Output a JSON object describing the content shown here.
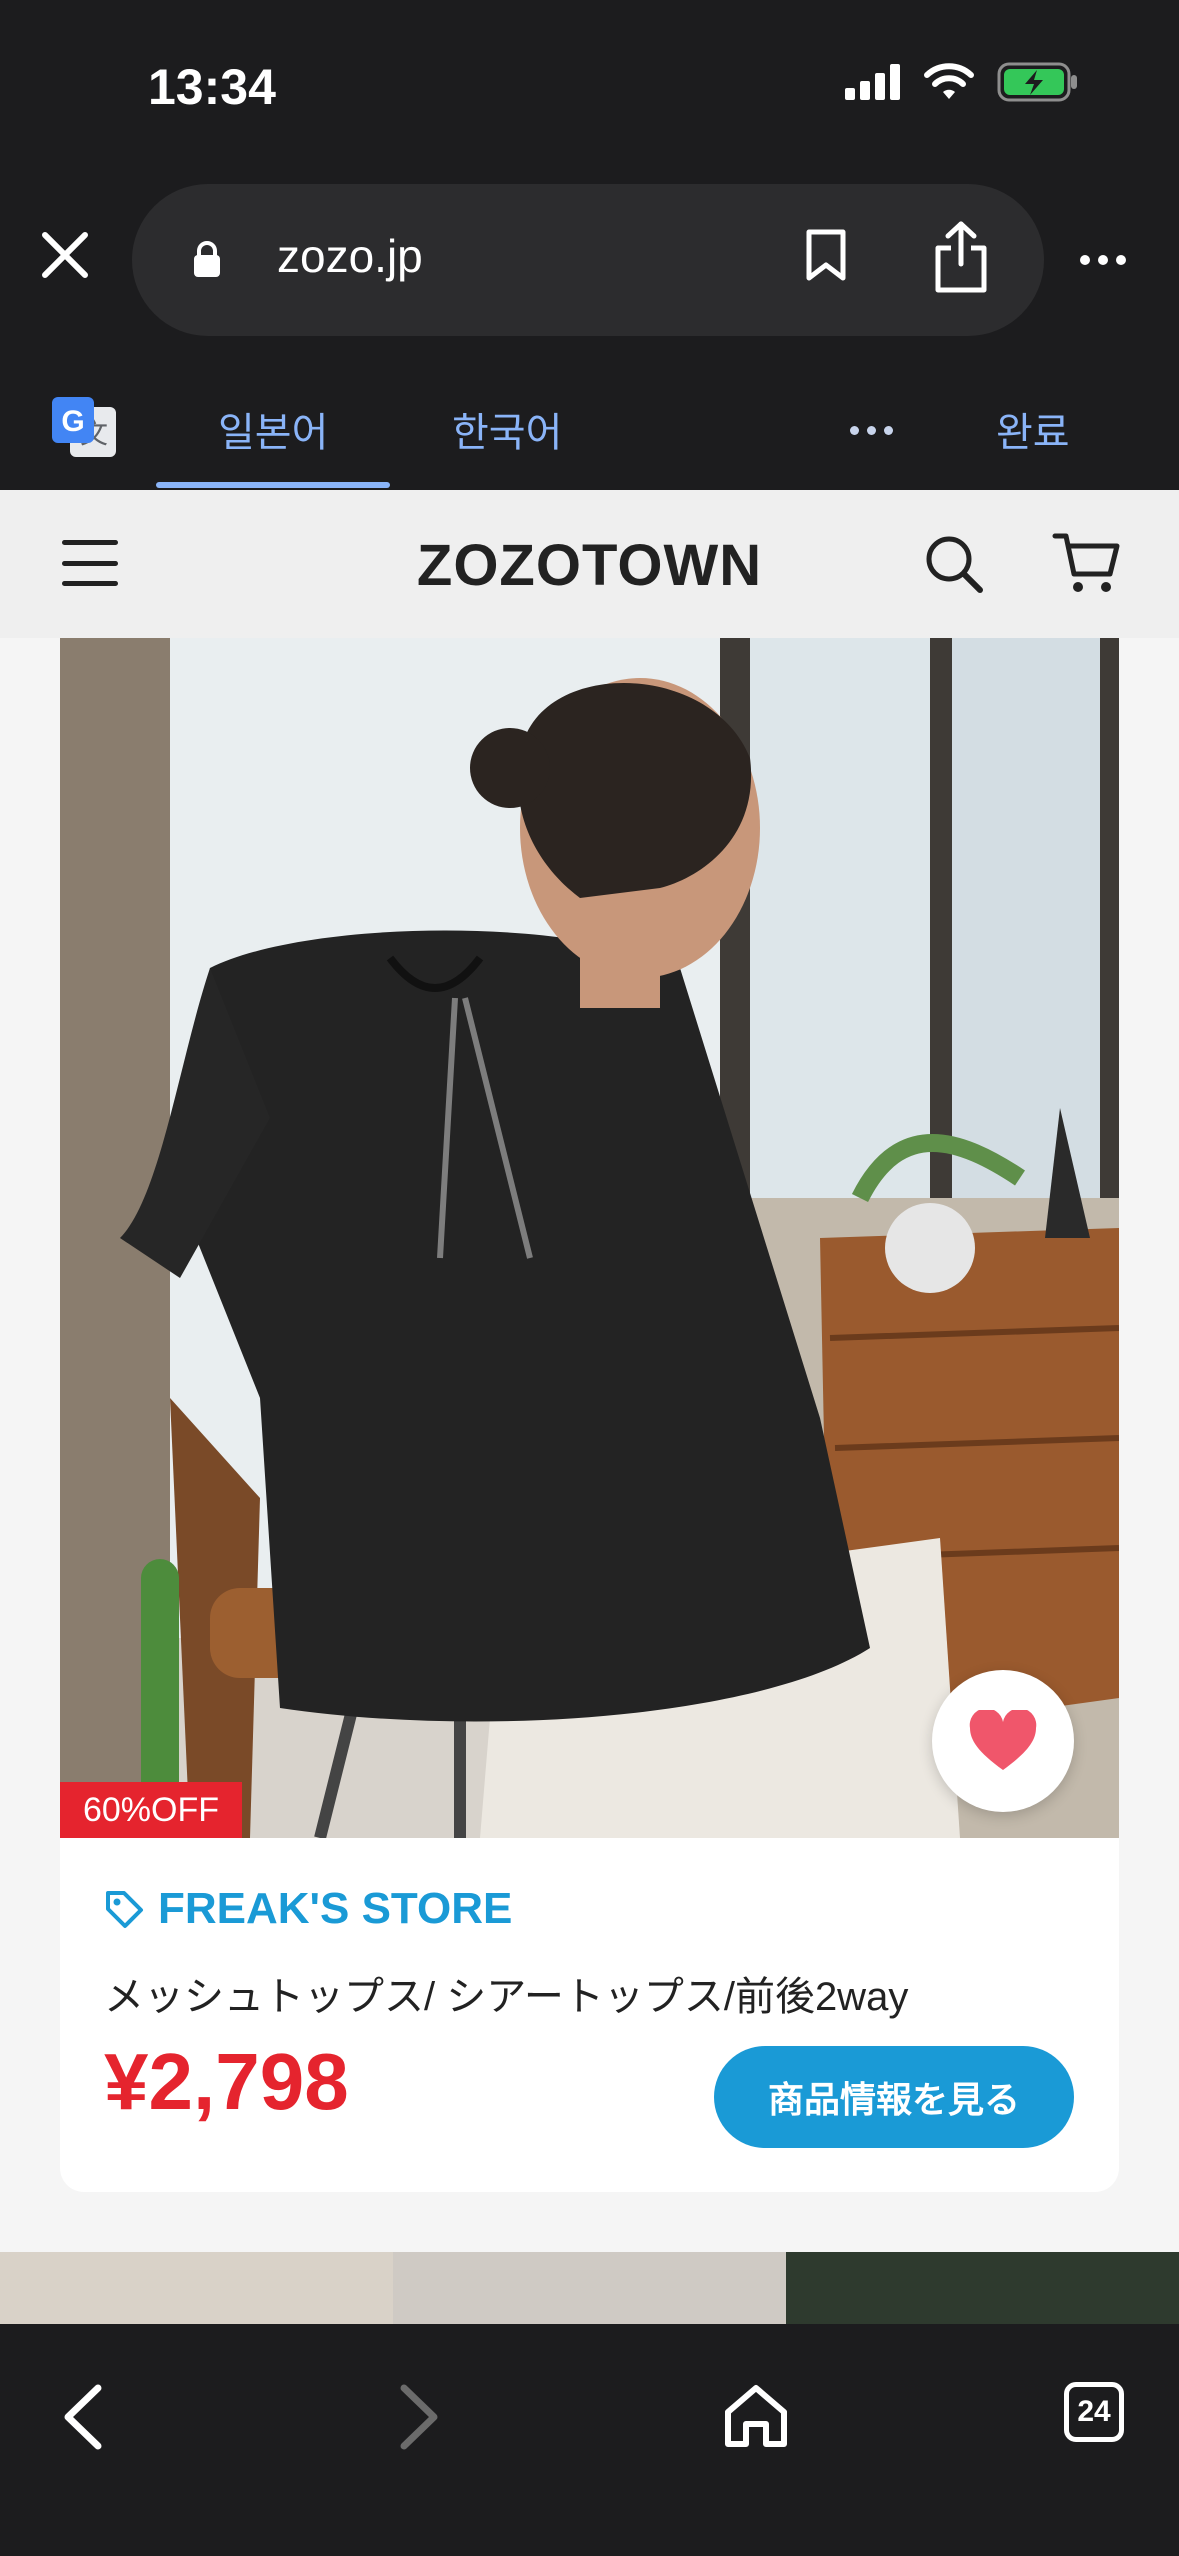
{
  "status": {
    "time": "13:34",
    "icons": [
      "signal-icon",
      "wifi-icon",
      "battery-charging-icon"
    ]
  },
  "browser": {
    "url": "zozo.jp",
    "icons": [
      "close-icon",
      "lock-icon",
      "bookmark-icon",
      "share-icon",
      "more-icon"
    ]
  },
  "translate": {
    "tabs": [
      "일본어",
      "한국어"
    ],
    "done_label": "완료",
    "active_tab": "일본어"
  },
  "site": {
    "logo": "ZOZOTOWN"
  },
  "product": {
    "discount": "60%OFF",
    "brand": "FREAK'S STORE",
    "title": "メッシュトップス/ シアートップス/前後2way",
    "price": "¥2,798",
    "cta_label": "商品情報を見る"
  },
  "toolbar": {
    "tab_count": "24"
  },
  "colors": {
    "brand_blue": "#1a9ad6",
    "sale_red": "#e5242e",
    "browser_dark": "#1c1c1e",
    "translate_blue": "#8ab4f8"
  }
}
